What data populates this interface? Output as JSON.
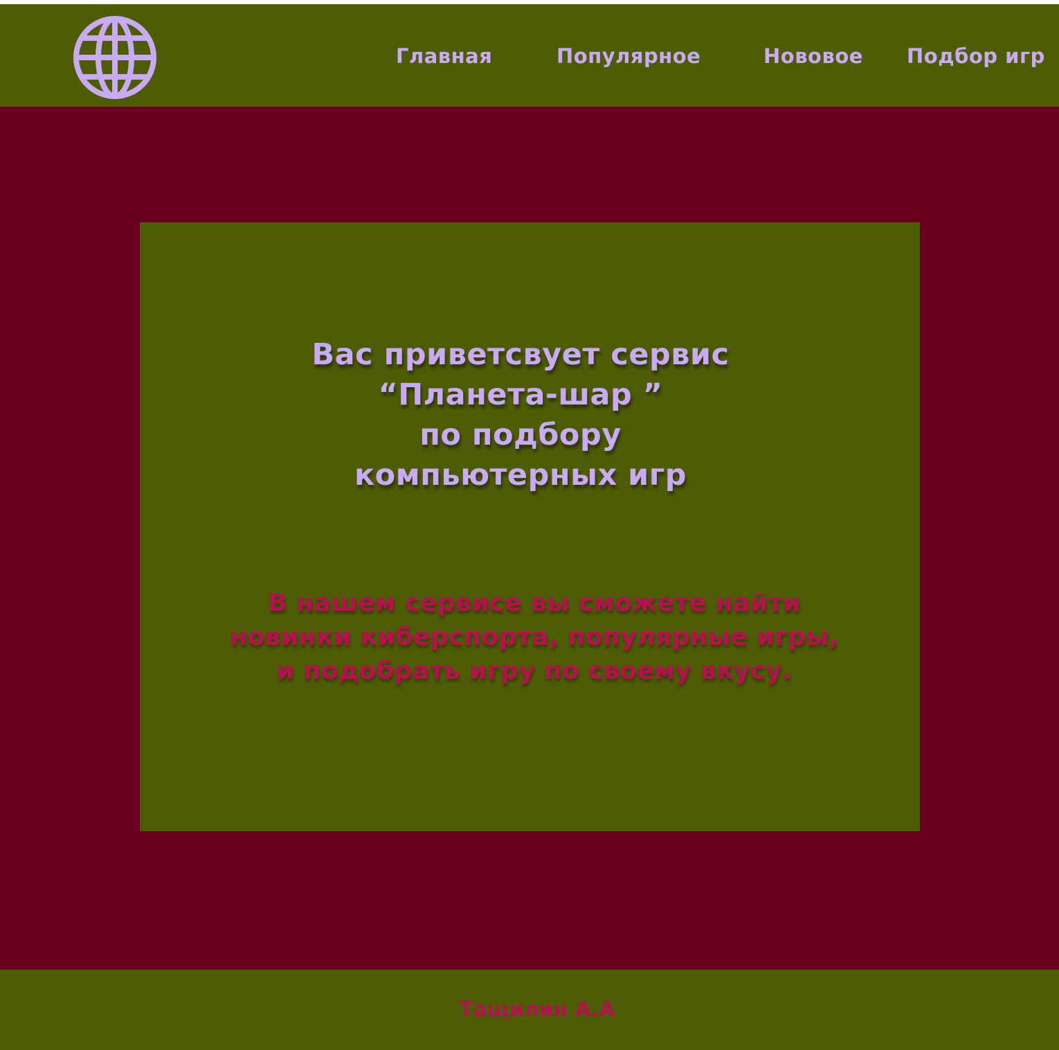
{
  "header": {
    "logo_icon": "globe-icon",
    "nav": [
      {
        "label": "Главная"
      },
      {
        "label": "Популярное"
      },
      {
        "label": "Нововое"
      },
      {
        "label": "Подбор игр"
      }
    ]
  },
  "hero": {
    "welcome_lines": [
      "Вас приветсвует сервис",
      "“Планета-шар ”",
      "по подбору",
      "компьютерных игр"
    ],
    "intro_lines": [
      "В нашем сервисе вы сможете найти",
      "новинки киберспорта, популярные игры,",
      "и подобрать игру по своему вкусу."
    ]
  },
  "footer": {
    "author": "Тащилин А.А"
  },
  "colors": {
    "olive": "#4f5c06",
    "burgundy": "#6b0020",
    "lavender": "#c8aaf5",
    "crimson": "#b3134d"
  }
}
